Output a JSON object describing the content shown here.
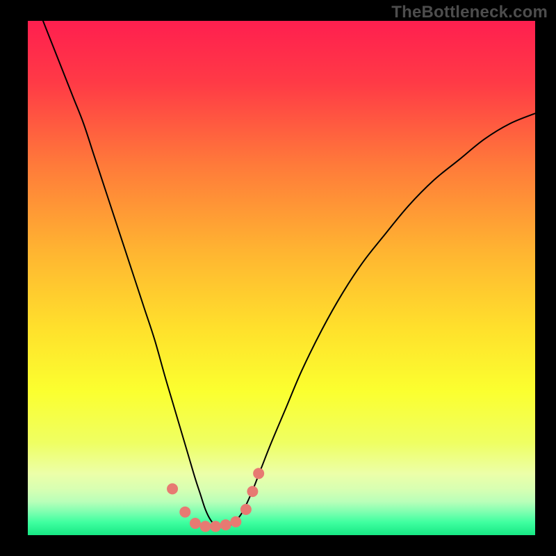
{
  "watermark": "TheBottleneck.com",
  "chart_data": {
    "type": "line",
    "title": "",
    "xlabel": "",
    "ylabel": "",
    "xlim": [
      0,
      100
    ],
    "ylim": [
      0,
      100
    ],
    "grid": false,
    "legend": false,
    "background_gradient": {
      "stops": [
        {
          "pos": 0.0,
          "color": "#ff1f4f"
        },
        {
          "pos": 0.12,
          "color": "#ff3a46"
        },
        {
          "pos": 0.28,
          "color": "#ff7a3a"
        },
        {
          "pos": 0.45,
          "color": "#ffb531"
        },
        {
          "pos": 0.6,
          "color": "#ffe12c"
        },
        {
          "pos": 0.72,
          "color": "#fbff2f"
        },
        {
          "pos": 0.82,
          "color": "#efff62"
        },
        {
          "pos": 0.88,
          "color": "#ecffa8"
        },
        {
          "pos": 0.91,
          "color": "#d8ffb2"
        },
        {
          "pos": 0.935,
          "color": "#b9ffb9"
        },
        {
          "pos": 0.955,
          "color": "#7effb0"
        },
        {
          "pos": 0.975,
          "color": "#3fffa0"
        },
        {
          "pos": 1.0,
          "color": "#17e884"
        }
      ]
    },
    "series": [
      {
        "name": "bottleneck-curve",
        "stroke": "#000000",
        "stroke_width": 2,
        "x": [
          3,
          5,
          7,
          9,
          11,
          13,
          15,
          17,
          19,
          21,
          23,
          25,
          27,
          28.5,
          30,
          31.5,
          33,
          34,
          35,
          36,
          37,
          38.5,
          40,
          42,
          44,
          46,
          48,
          51,
          54,
          58,
          62,
          66,
          70,
          75,
          80,
          85,
          90,
          95,
          100
        ],
        "y": [
          100,
          95,
          90,
          85,
          80,
          74,
          68,
          62,
          56,
          50,
          44,
          38,
          31,
          26,
          21,
          16,
          11,
          8,
          5,
          3,
          2,
          1.7,
          2,
          4,
          8,
          13,
          18,
          25,
          32,
          40,
          47,
          53,
          58,
          64,
          69,
          73,
          77,
          80,
          82
        ]
      }
    ],
    "markers": {
      "name": "highlight-dots",
      "color": "#e77a72",
      "radius": 8,
      "points": [
        {
          "x": 28.5,
          "y": 9
        },
        {
          "x": 31.0,
          "y": 4.5
        },
        {
          "x": 33.0,
          "y": 2.3
        },
        {
          "x": 35.0,
          "y": 1.7
        },
        {
          "x": 37.0,
          "y": 1.7
        },
        {
          "x": 39.0,
          "y": 2.0
        },
        {
          "x": 41.0,
          "y": 2.6
        },
        {
          "x": 43.0,
          "y": 5.0
        },
        {
          "x": 44.3,
          "y": 8.5
        },
        {
          "x": 45.5,
          "y": 12.0
        }
      ]
    }
  }
}
